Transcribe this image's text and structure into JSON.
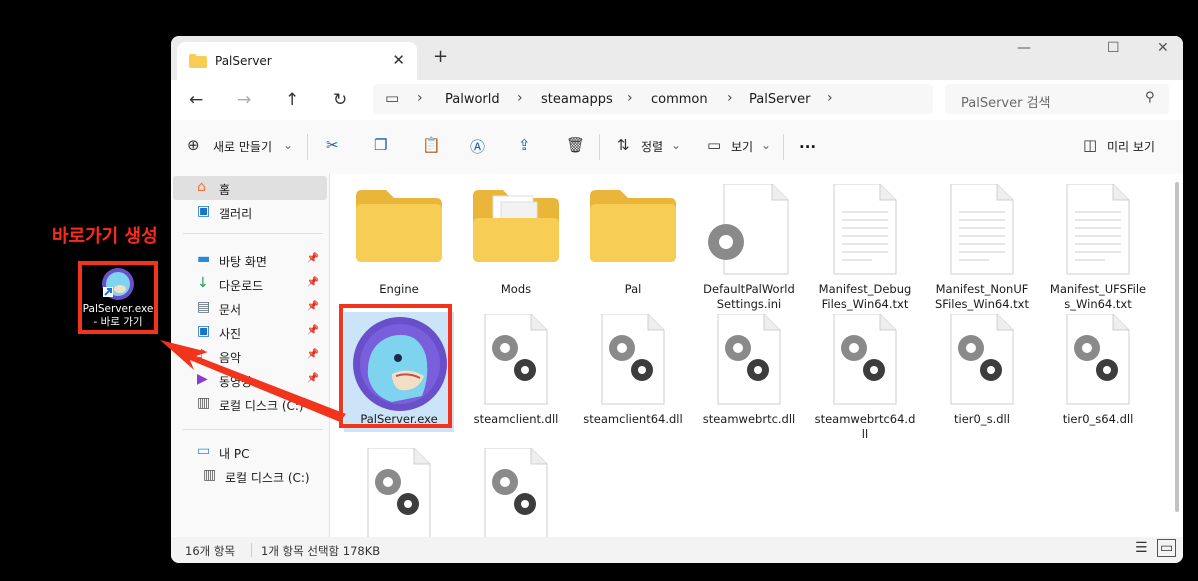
{
  "window": {
    "tab_title": "PalServer",
    "new_tab": "+"
  },
  "address": {
    "crumbs": [
      "Palworld",
      "steamapps",
      "common",
      "PalServer"
    ]
  },
  "search": {
    "placeholder": "PalServer 검색"
  },
  "toolbar": {
    "new_label": "새로 만들기",
    "sort_label": "정렬",
    "view_label": "보기",
    "more_label": "...",
    "preview_label": "미리 보기"
  },
  "sidebar": {
    "items": [
      {
        "label": "홈",
        "icon": "home-icon"
      },
      {
        "label": "갤러리",
        "icon": "gallery-icon"
      },
      {
        "label": "바탕 화면",
        "icon": "desktop-icon"
      },
      {
        "label": "다운로드",
        "icon": "download-icon"
      },
      {
        "label": "문서",
        "icon": "document-icon"
      },
      {
        "label": "사진",
        "icon": "picture-icon"
      },
      {
        "label": "음악",
        "icon": "music-icon"
      },
      {
        "label": "동영상",
        "icon": "video-icon"
      },
      {
        "label": "로컬 디스크 (C:)",
        "icon": "drive-icon"
      },
      {
        "label": "내 PC",
        "icon": "pc-icon"
      },
      {
        "label": "로컬 디스크 (C:)",
        "icon": "drive-icon"
      }
    ]
  },
  "files": [
    {
      "name": "Engine",
      "type": "folder"
    },
    {
      "name": "Mods",
      "type": "folder-with-files"
    },
    {
      "name": "Pal",
      "type": "folder"
    },
    {
      "name": "DefaultPalWorld Settings.ini",
      "type": "ini"
    },
    {
      "name": "Manifest_Debug Files_Win64.txt",
      "type": "txt"
    },
    {
      "name": "Manifest_NonUF SFiles_Win64.txt",
      "type": "txt"
    },
    {
      "name": "Manifest_UFSFile s_Win64.txt",
      "type": "txt"
    },
    {
      "name": "PalServer.exe",
      "type": "exe"
    },
    {
      "name": "steamclient.dll",
      "type": "dll"
    },
    {
      "name": "steamclient64.dll",
      "type": "dll"
    },
    {
      "name": "steamwebrtc.dll",
      "type": "dll"
    },
    {
      "name": "steamwebrtc64.d ll",
      "type": "dll"
    },
    {
      "name": "tier0_s.dll",
      "type": "dll"
    },
    {
      "name": "tier0_s64.dll",
      "type": "dll"
    },
    {
      "name": "",
      "type": "dll"
    },
    {
      "name": "",
      "type": "dll"
    }
  ],
  "status": {
    "count": "16개 항목",
    "selection": "1개 항목 선택함 178KB"
  },
  "annotation": {
    "title": "바로가기 생성",
    "shortcut_label": "PalServer.exe - 바로 가기"
  },
  "colors": {
    "accent": "#f2341c",
    "folder": "#f7cd55"
  }
}
